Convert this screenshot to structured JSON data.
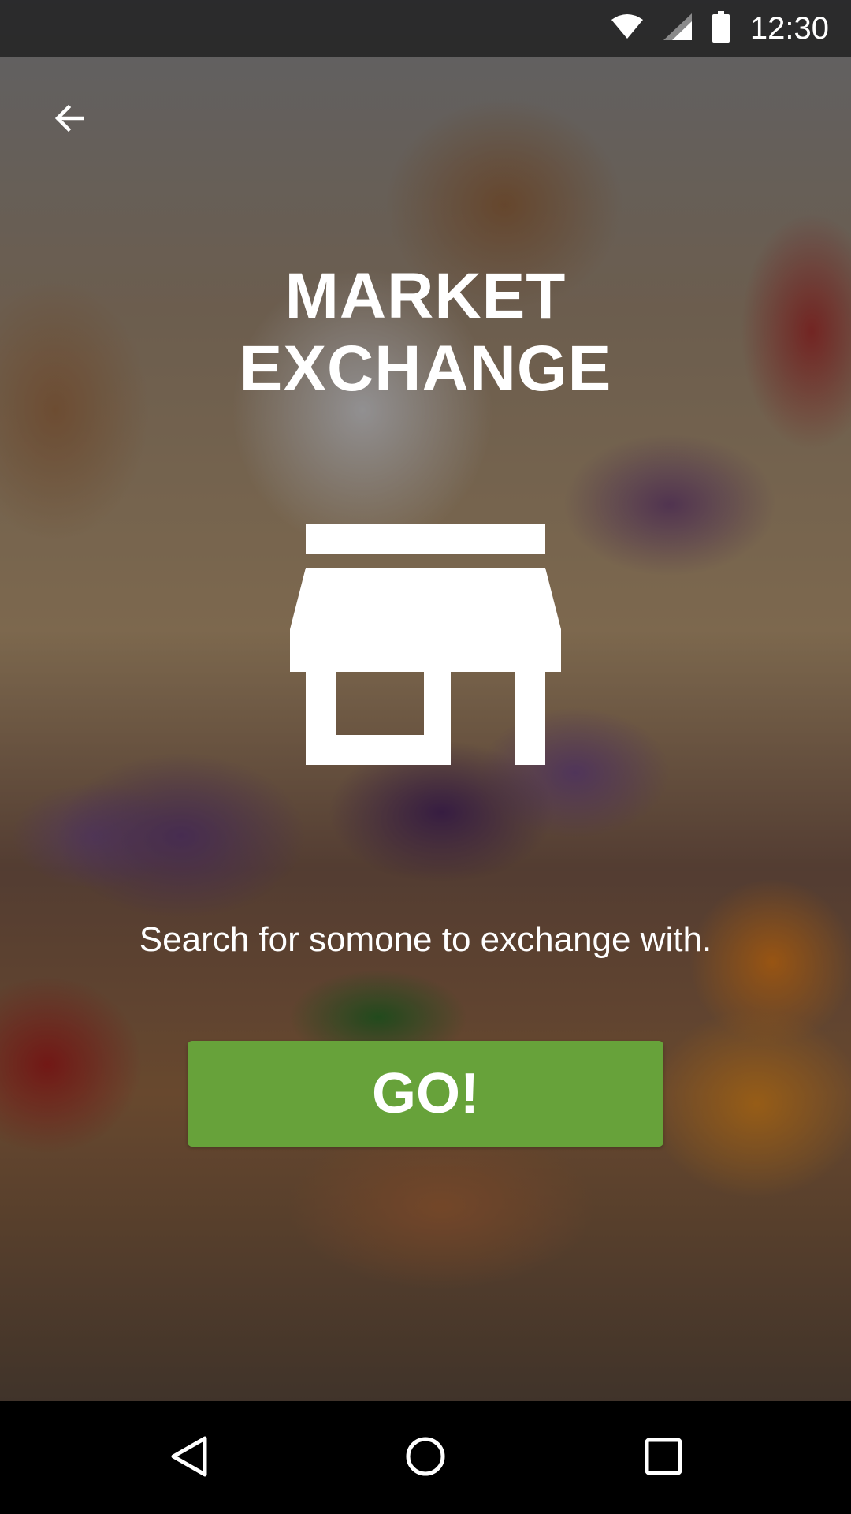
{
  "status_bar": {
    "time": "12:30",
    "icons": [
      "wifi-icon",
      "cell-signal-icon",
      "battery-icon"
    ]
  },
  "header": {
    "back_icon": "arrow-left-icon"
  },
  "title": {
    "line1": "MARKET",
    "line2": "EXCHANGE"
  },
  "hero_icon": "store-icon",
  "prompt": "Search for somone to exchange with.",
  "go_button": {
    "label": "GO!"
  },
  "colors": {
    "accent": "#67a23a",
    "text": "#ffffff",
    "nav_background": "#000000"
  },
  "nav_bar": {
    "items": [
      "back",
      "home",
      "recents"
    ]
  }
}
